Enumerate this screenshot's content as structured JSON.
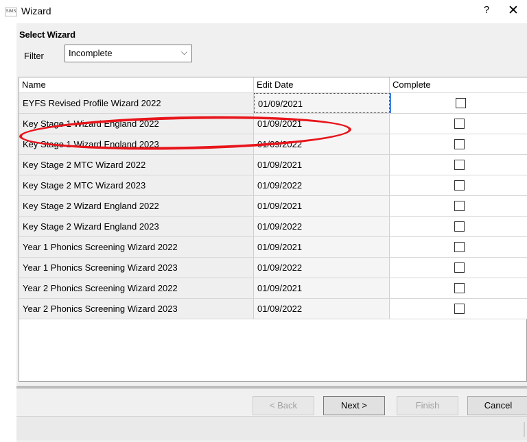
{
  "window": {
    "app_logo_text": "SIMS",
    "title": "Wizard",
    "help_label": "?",
    "close_label": "✕"
  },
  "panel": {
    "section_title": "Select Wizard",
    "filter_label": "Filter",
    "filter_value": "Incomplete",
    "filter_chevron": "⌵"
  },
  "grid": {
    "columns": [
      "Name",
      "Edit Date",
      "Complete"
    ],
    "selected_row": 0,
    "rows": [
      {
        "name": "EYFS Revised Profile Wizard 2022",
        "edit_date": "01/09/2021",
        "complete": false
      },
      {
        "name": "Key Stage 1 Wizard England 2022",
        "edit_date": "01/09/2021",
        "complete": false
      },
      {
        "name": "Key Stage 1 Wizard England 2023",
        "edit_date": "01/09/2022",
        "complete": false
      },
      {
        "name": "Key Stage 2 MTC Wizard 2022",
        "edit_date": "01/09/2021",
        "complete": false
      },
      {
        "name": "Key Stage 2 MTC Wizard 2023",
        "edit_date": "01/09/2022",
        "complete": false
      },
      {
        "name": "Key Stage 2 Wizard England 2022",
        "edit_date": "01/09/2021",
        "complete": false
      },
      {
        "name": "Key Stage 2 Wizard England 2023",
        "edit_date": "01/09/2022",
        "complete": false
      },
      {
        "name": "Year 1 Phonics Screening Wizard 2022",
        "edit_date": "01/09/2021",
        "complete": false
      },
      {
        "name": "Year 1 Phonics Screening Wizard 2023",
        "edit_date": "01/09/2022",
        "complete": false
      },
      {
        "name": "Year 2 Phonics Screening Wizard 2022",
        "edit_date": "01/09/2021",
        "complete": false
      },
      {
        "name": "Year 2 Phonics Screening Wizard 2023",
        "edit_date": "01/09/2022",
        "complete": false
      }
    ]
  },
  "buttons": {
    "back": "< Back",
    "next": "Next >",
    "finish": "Finish",
    "cancel": "Cancel"
  },
  "annotation": {
    "highlighted_row": 2,
    "color": "#e8151b"
  }
}
